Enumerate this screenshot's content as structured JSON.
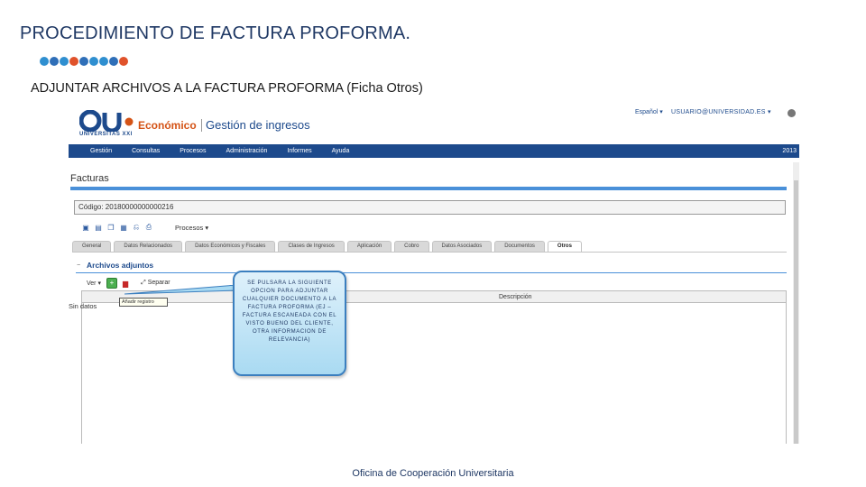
{
  "slide": {
    "title": "PROCEDIMIENTO DE FACTURA PROFORMA.",
    "subtitle": "ADJUNTAR ARCHIVOS A LA FACTURA PROFORMA (Ficha Otros)",
    "footer": "Oficina de Cooperación Universitaria",
    "dot_colors": [
      "#2f8fd0",
      "#2f6fb8",
      "#2f8fd0",
      "#e0522b",
      "#2f6fb8",
      "#2f8fd0",
      "#2f8fd0",
      "#2f6fb8",
      "#e0522b"
    ]
  },
  "app": {
    "logo_text": "UNIVERSITAS XXI",
    "product": "Económico",
    "module": "Gestión de ingresos",
    "language": "Español",
    "user": "USUARIO@UNIVERSIDAD.ES",
    "menu": [
      "Gestión",
      "Consultas",
      "Procesos",
      "Administración",
      "Informes",
      "Ayuda"
    ],
    "year": "2013",
    "colors": {
      "brand_blue": "#1d4a8c",
      "brand_orange": "#d45316",
      "accent_line": "#4a90d9"
    }
  },
  "page": {
    "title": "Facturas",
    "code": "Código: 20180000000000216",
    "procesos_label": "Procesos",
    "tabs": [
      {
        "label": "General",
        "active": false
      },
      {
        "label": "Datos Relacionados",
        "active": false
      },
      {
        "label": "Datos Económicos y Fiscales",
        "active": false
      },
      {
        "label": "Clases de Ingresos",
        "active": false
      },
      {
        "label": "Aplicación",
        "active": false
      },
      {
        "label": "Cobro",
        "active": false
      },
      {
        "label": "Datos Asociados",
        "active": false
      },
      {
        "label": "Documentos",
        "active": false
      },
      {
        "label": "Otros",
        "active": true
      }
    ]
  },
  "attachments": {
    "toggle": "−",
    "section_title": "Archivos adjuntos",
    "ver_label": "Ver",
    "separar_label": "Separar",
    "tooltip": "Añadir registro",
    "column_description": "Descripción",
    "no_data": "Sin datos"
  },
  "callout": {
    "text": "SE PULSARA LA SIGUIENTE OPCION PARA ADJUNTAR CUALQUIER DOCUMENTO A LA FACTURA PROFORMA (EJ – FACTURA ESCANEADA CON EL VISTO BUENO DEL CLIENTE, OTRA INFORMACION DE RELEVANCIA)"
  }
}
